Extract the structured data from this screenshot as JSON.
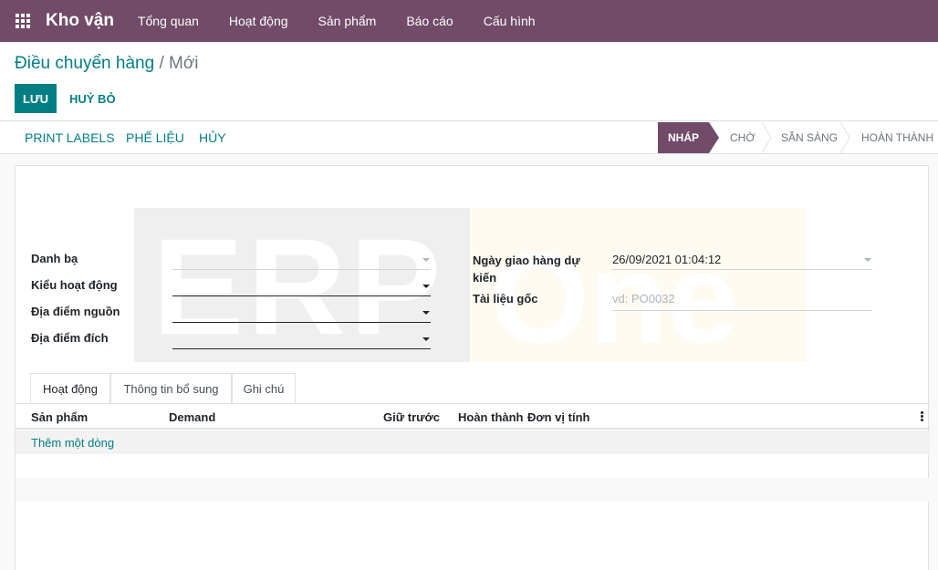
{
  "navbar": {
    "apps_icon": "grid-icon",
    "brand": "Kho vận",
    "menu": [
      "Tổng quan",
      "Hoạt động",
      "Sản phẩm",
      "Báo cáo",
      "Cấu hình"
    ]
  },
  "breadcrumb": {
    "parent": "Điều chuyển hàng",
    "separator": "/",
    "current": "Mới"
  },
  "actions": {
    "save_label": "LƯU",
    "discard_label": "HUỶ BỎ"
  },
  "statusbar": {
    "buttons": [
      "PRINT LABELS",
      "PHẾ LIỆU",
      "HỦY"
    ],
    "stages": [
      "NHÁP",
      "CHỜ",
      "SẴN SÀNG",
      "HOÀN THÀNH"
    ],
    "active_stage": "NHÁP"
  },
  "form": {
    "left": {
      "contact_label": "Danh bạ",
      "contact_value": "",
      "operation_type_label": "Kiểu hoạt động",
      "operation_type_value": "",
      "source_location_label": "Địa điểm nguồn",
      "source_location_value": "",
      "dest_location_label": "Địa điểm đích",
      "dest_location_value": ""
    },
    "right": {
      "scheduled_date_label": "Ngày giao hàng dự kiến",
      "scheduled_date_value": "26/09/2021 01:04:12",
      "source_document_label": "Tài liệu gốc",
      "source_document_placeholder": "vd: PO0032"
    }
  },
  "watermark": {
    "text_left": "ERP",
    "text_right": "One"
  },
  "tabs": [
    "Hoạt động",
    "Thông tin bổ sung",
    "Ghi chú"
  ],
  "table": {
    "columns": [
      "Sản phẩm",
      "Demand",
      "Giữ trước",
      "Hoàn thành",
      "Đơn vị tính"
    ],
    "add_line_label": "Thêm một dòng"
  },
  "colors": {
    "primary": "#714b67",
    "accent": "#017e84"
  }
}
